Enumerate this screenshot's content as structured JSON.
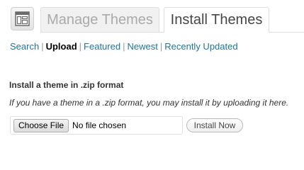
{
  "header": {
    "icon": "themes-icon",
    "tabs": [
      {
        "label": "Manage Themes",
        "active": false
      },
      {
        "label": "Install Themes",
        "active": true
      }
    ]
  },
  "subnav": {
    "items": [
      {
        "label": "Search",
        "current": false
      },
      {
        "label": "Upload",
        "current": true
      },
      {
        "label": "Featured",
        "current": false
      },
      {
        "label": "Newest",
        "current": false
      },
      {
        "label": "Recently Updated",
        "current": false
      }
    ],
    "separator": "|"
  },
  "upload": {
    "title": "Install a theme in .zip format",
    "description": "If you have a theme in a .zip format, you may install it by uploading it here.",
    "choose_file_label": "Choose File",
    "no_file_text": "No file chosen",
    "install_button_label": "Install Now"
  },
  "colors": {
    "link": "#21759b",
    "inactive_tab_text": "#aaaaaa",
    "active_tab_text": "#464646"
  }
}
